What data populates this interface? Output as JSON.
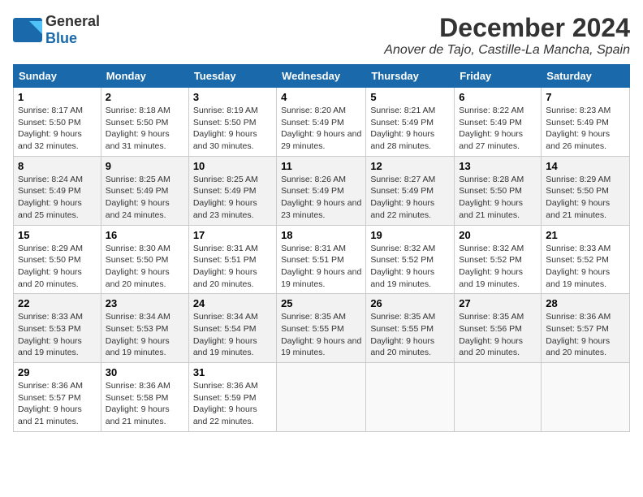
{
  "header": {
    "logo_general": "General",
    "logo_blue": "Blue",
    "month_title": "December 2024",
    "location": "Anover de Tajo, Castille-La Mancha, Spain"
  },
  "weekdays": [
    "Sunday",
    "Monday",
    "Tuesday",
    "Wednesday",
    "Thursday",
    "Friday",
    "Saturday"
  ],
  "weeks": [
    [
      {
        "day": "1",
        "sunrise": "Sunrise: 8:17 AM",
        "sunset": "Sunset: 5:50 PM",
        "daylight": "Daylight: 9 hours and 32 minutes."
      },
      {
        "day": "2",
        "sunrise": "Sunrise: 8:18 AM",
        "sunset": "Sunset: 5:50 PM",
        "daylight": "Daylight: 9 hours and 31 minutes."
      },
      {
        "day": "3",
        "sunrise": "Sunrise: 8:19 AM",
        "sunset": "Sunset: 5:50 PM",
        "daylight": "Daylight: 9 hours and 30 minutes."
      },
      {
        "day": "4",
        "sunrise": "Sunrise: 8:20 AM",
        "sunset": "Sunset: 5:49 PM",
        "daylight": "Daylight: 9 hours and 29 minutes."
      },
      {
        "day": "5",
        "sunrise": "Sunrise: 8:21 AM",
        "sunset": "Sunset: 5:49 PM",
        "daylight": "Daylight: 9 hours and 28 minutes."
      },
      {
        "day": "6",
        "sunrise": "Sunrise: 8:22 AM",
        "sunset": "Sunset: 5:49 PM",
        "daylight": "Daylight: 9 hours and 27 minutes."
      },
      {
        "day": "7",
        "sunrise": "Sunrise: 8:23 AM",
        "sunset": "Sunset: 5:49 PM",
        "daylight": "Daylight: 9 hours and 26 minutes."
      }
    ],
    [
      {
        "day": "8",
        "sunrise": "Sunrise: 8:24 AM",
        "sunset": "Sunset: 5:49 PM",
        "daylight": "Daylight: 9 hours and 25 minutes."
      },
      {
        "day": "9",
        "sunrise": "Sunrise: 8:25 AM",
        "sunset": "Sunset: 5:49 PM",
        "daylight": "Daylight: 9 hours and 24 minutes."
      },
      {
        "day": "10",
        "sunrise": "Sunrise: 8:25 AM",
        "sunset": "Sunset: 5:49 PM",
        "daylight": "Daylight: 9 hours and 23 minutes."
      },
      {
        "day": "11",
        "sunrise": "Sunrise: 8:26 AM",
        "sunset": "Sunset: 5:49 PM",
        "daylight": "Daylight: 9 hours and 23 minutes."
      },
      {
        "day": "12",
        "sunrise": "Sunrise: 8:27 AM",
        "sunset": "Sunset: 5:49 PM",
        "daylight": "Daylight: 9 hours and 22 minutes."
      },
      {
        "day": "13",
        "sunrise": "Sunrise: 8:28 AM",
        "sunset": "Sunset: 5:50 PM",
        "daylight": "Daylight: 9 hours and 21 minutes."
      },
      {
        "day": "14",
        "sunrise": "Sunrise: 8:29 AM",
        "sunset": "Sunset: 5:50 PM",
        "daylight": "Daylight: 9 hours and 21 minutes."
      }
    ],
    [
      {
        "day": "15",
        "sunrise": "Sunrise: 8:29 AM",
        "sunset": "Sunset: 5:50 PM",
        "daylight": "Daylight: 9 hours and 20 minutes."
      },
      {
        "day": "16",
        "sunrise": "Sunrise: 8:30 AM",
        "sunset": "Sunset: 5:50 PM",
        "daylight": "Daylight: 9 hours and 20 minutes."
      },
      {
        "day": "17",
        "sunrise": "Sunrise: 8:31 AM",
        "sunset": "Sunset: 5:51 PM",
        "daylight": "Daylight: 9 hours and 20 minutes."
      },
      {
        "day": "18",
        "sunrise": "Sunrise: 8:31 AM",
        "sunset": "Sunset: 5:51 PM",
        "daylight": "Daylight: 9 hours and 19 minutes."
      },
      {
        "day": "19",
        "sunrise": "Sunrise: 8:32 AM",
        "sunset": "Sunset: 5:52 PM",
        "daylight": "Daylight: 9 hours and 19 minutes."
      },
      {
        "day": "20",
        "sunrise": "Sunrise: 8:32 AM",
        "sunset": "Sunset: 5:52 PM",
        "daylight": "Daylight: 9 hours and 19 minutes."
      },
      {
        "day": "21",
        "sunrise": "Sunrise: 8:33 AM",
        "sunset": "Sunset: 5:52 PM",
        "daylight": "Daylight: 9 hours and 19 minutes."
      }
    ],
    [
      {
        "day": "22",
        "sunrise": "Sunrise: 8:33 AM",
        "sunset": "Sunset: 5:53 PM",
        "daylight": "Daylight: 9 hours and 19 minutes."
      },
      {
        "day": "23",
        "sunrise": "Sunrise: 8:34 AM",
        "sunset": "Sunset: 5:53 PM",
        "daylight": "Daylight: 9 hours and 19 minutes."
      },
      {
        "day": "24",
        "sunrise": "Sunrise: 8:34 AM",
        "sunset": "Sunset: 5:54 PM",
        "daylight": "Daylight: 9 hours and 19 minutes."
      },
      {
        "day": "25",
        "sunrise": "Sunrise: 8:35 AM",
        "sunset": "Sunset: 5:55 PM",
        "daylight": "Daylight: 9 hours and 19 minutes."
      },
      {
        "day": "26",
        "sunrise": "Sunrise: 8:35 AM",
        "sunset": "Sunset: 5:55 PM",
        "daylight": "Daylight: 9 hours and 20 minutes."
      },
      {
        "day": "27",
        "sunrise": "Sunrise: 8:35 AM",
        "sunset": "Sunset: 5:56 PM",
        "daylight": "Daylight: 9 hours and 20 minutes."
      },
      {
        "day": "28",
        "sunrise": "Sunrise: 8:36 AM",
        "sunset": "Sunset: 5:57 PM",
        "daylight": "Daylight: 9 hours and 20 minutes."
      }
    ],
    [
      {
        "day": "29",
        "sunrise": "Sunrise: 8:36 AM",
        "sunset": "Sunset: 5:57 PM",
        "daylight": "Daylight: 9 hours and 21 minutes."
      },
      {
        "day": "30",
        "sunrise": "Sunrise: 8:36 AM",
        "sunset": "Sunset: 5:58 PM",
        "daylight": "Daylight: 9 hours and 21 minutes."
      },
      {
        "day": "31",
        "sunrise": "Sunrise: 8:36 AM",
        "sunset": "Sunset: 5:59 PM",
        "daylight": "Daylight: 9 hours and 22 minutes."
      },
      null,
      null,
      null,
      null
    ]
  ]
}
